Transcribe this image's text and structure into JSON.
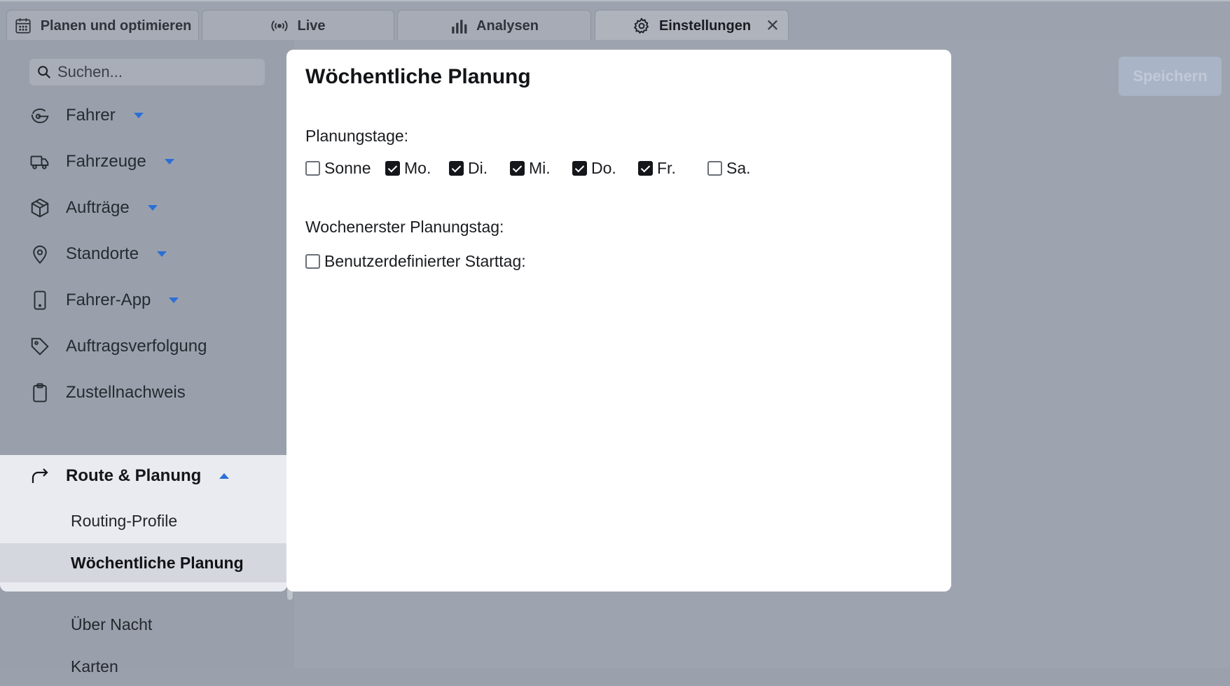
{
  "tabs": [
    {
      "label": "Planen und optimieren",
      "icon": "calendar-icon"
    },
    {
      "label": "Live",
      "icon": "broadcast-icon"
    },
    {
      "label": "Analysen",
      "icon": "bar-chart-icon"
    },
    {
      "label": "Einstellungen",
      "icon": "gear-icon",
      "active": true
    }
  ],
  "search": {
    "placeholder": "Suchen..."
  },
  "sidebar": {
    "items": [
      {
        "label": "Fahrer",
        "icon": "driver-icon",
        "dropdown": true
      },
      {
        "label": "Fahrzeuge",
        "icon": "truck-icon",
        "dropdown": true
      },
      {
        "label": "Aufträge",
        "icon": "package-icon",
        "dropdown": true
      },
      {
        "label": "Standorte",
        "icon": "location-pin-icon",
        "dropdown": true
      },
      {
        "label": "Fahrer-App",
        "icon": "phone-icon",
        "dropdown": true
      },
      {
        "label": "Auftragsverfolgung",
        "icon": "tag-icon"
      },
      {
        "label": "Zustellnachweis",
        "icon": "clipboard-icon"
      }
    ],
    "expanded": {
      "label": "Route & Planung",
      "icon": "route-arrow-icon",
      "children": [
        "Routing-Profile",
        "Wöchentliche Planung"
      ],
      "selected": "Wöchentliche Planung"
    },
    "more": [
      "Über Nacht",
      "Karten"
    ]
  },
  "toolbar": {
    "save_label": "Speichern"
  },
  "modal": {
    "title": "Wöchentliche Planung",
    "planning_days_label": "Planungstage:",
    "days": [
      {
        "label": "Sonne",
        "checked": false
      },
      {
        "label": "Mo.",
        "checked": true
      },
      {
        "label": "Di.",
        "checked": true
      },
      {
        "label": "Mi.",
        "checked": true
      },
      {
        "label": "Do.",
        "checked": true
      },
      {
        "label": "Fr.",
        "checked": true
      },
      {
        "label": "Sa.",
        "checked": false
      }
    ],
    "first_day_label": "Wochenerster Planungstag:",
    "custom_start": {
      "label": "Benutzerdefinierter Starttag:",
      "checked": false
    }
  },
  "colors": {
    "accent": "#2b6fd6",
    "modal_bg": "#ffffff",
    "overlay": "#9ea4af"
  }
}
